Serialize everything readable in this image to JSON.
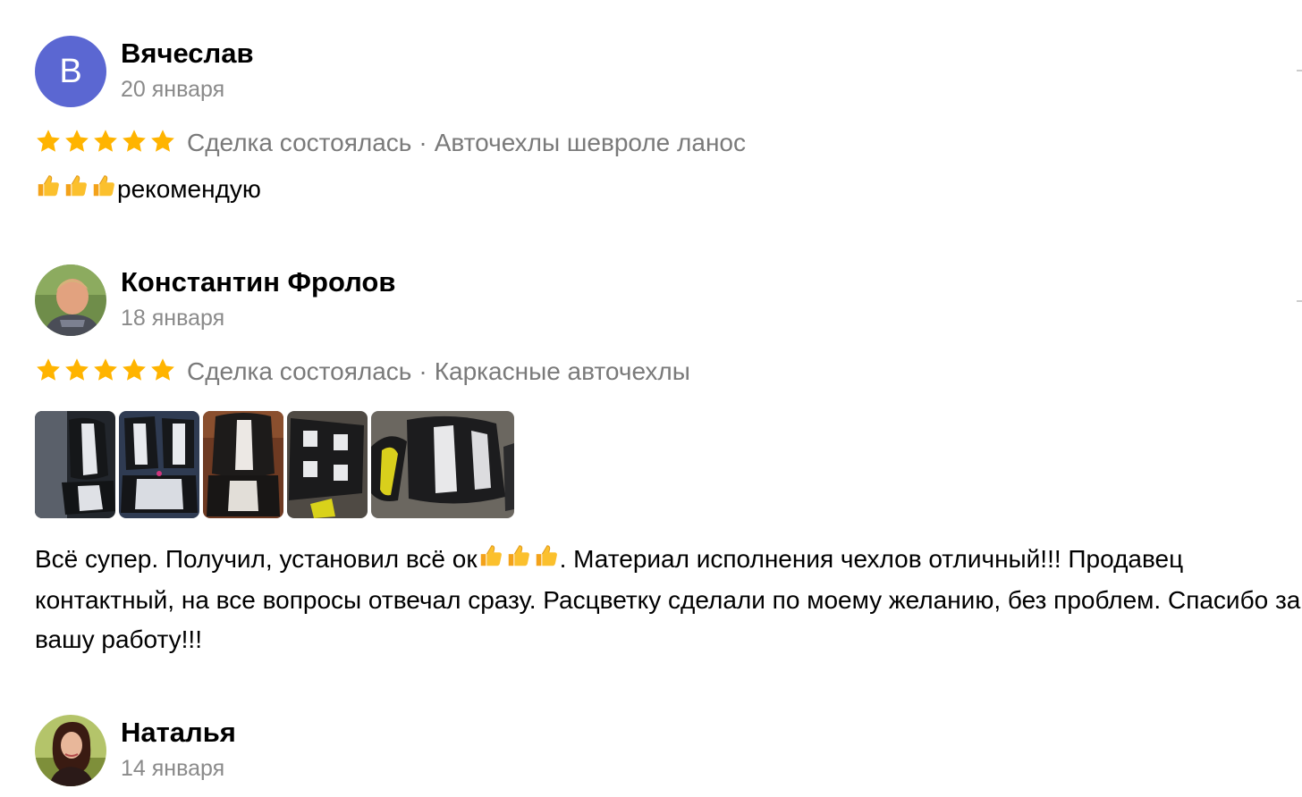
{
  "reviews": [
    {
      "author": "Вячеслав",
      "avatar_letter": "В",
      "avatar_color": "#5b67d2",
      "date": "20 января",
      "rating": 5,
      "deal_status": "Сделка состоялась",
      "item": "Авточехлы шевроле ланос",
      "text": "рекомендую"
    },
    {
      "author": "Константин Фролов",
      "date": "18 января",
      "rating": 5,
      "deal_status": "Сделка состоялась",
      "item": "Каркасные авточехлы",
      "photos_count": 5,
      "text": {
        "part1": "Всё супер. Получил, установил всё ок",
        "part2": ". Материал исполнения чехлов отличный!!! Продавец контактный, на все вопросы отвечал сразу. Расцветку сделали по моему желанию, без проблем. Спасибо за вашу работу!!!"
      }
    },
    {
      "author": "Наталья",
      "date": "14 января"
    }
  ],
  "colors": {
    "star": "#ffb400",
    "secondary_text": "#7a7a7a",
    "date_text": "#8a8a8a"
  },
  "icons": [
    "star-icon",
    "thumbs-up-emoji"
  ]
}
